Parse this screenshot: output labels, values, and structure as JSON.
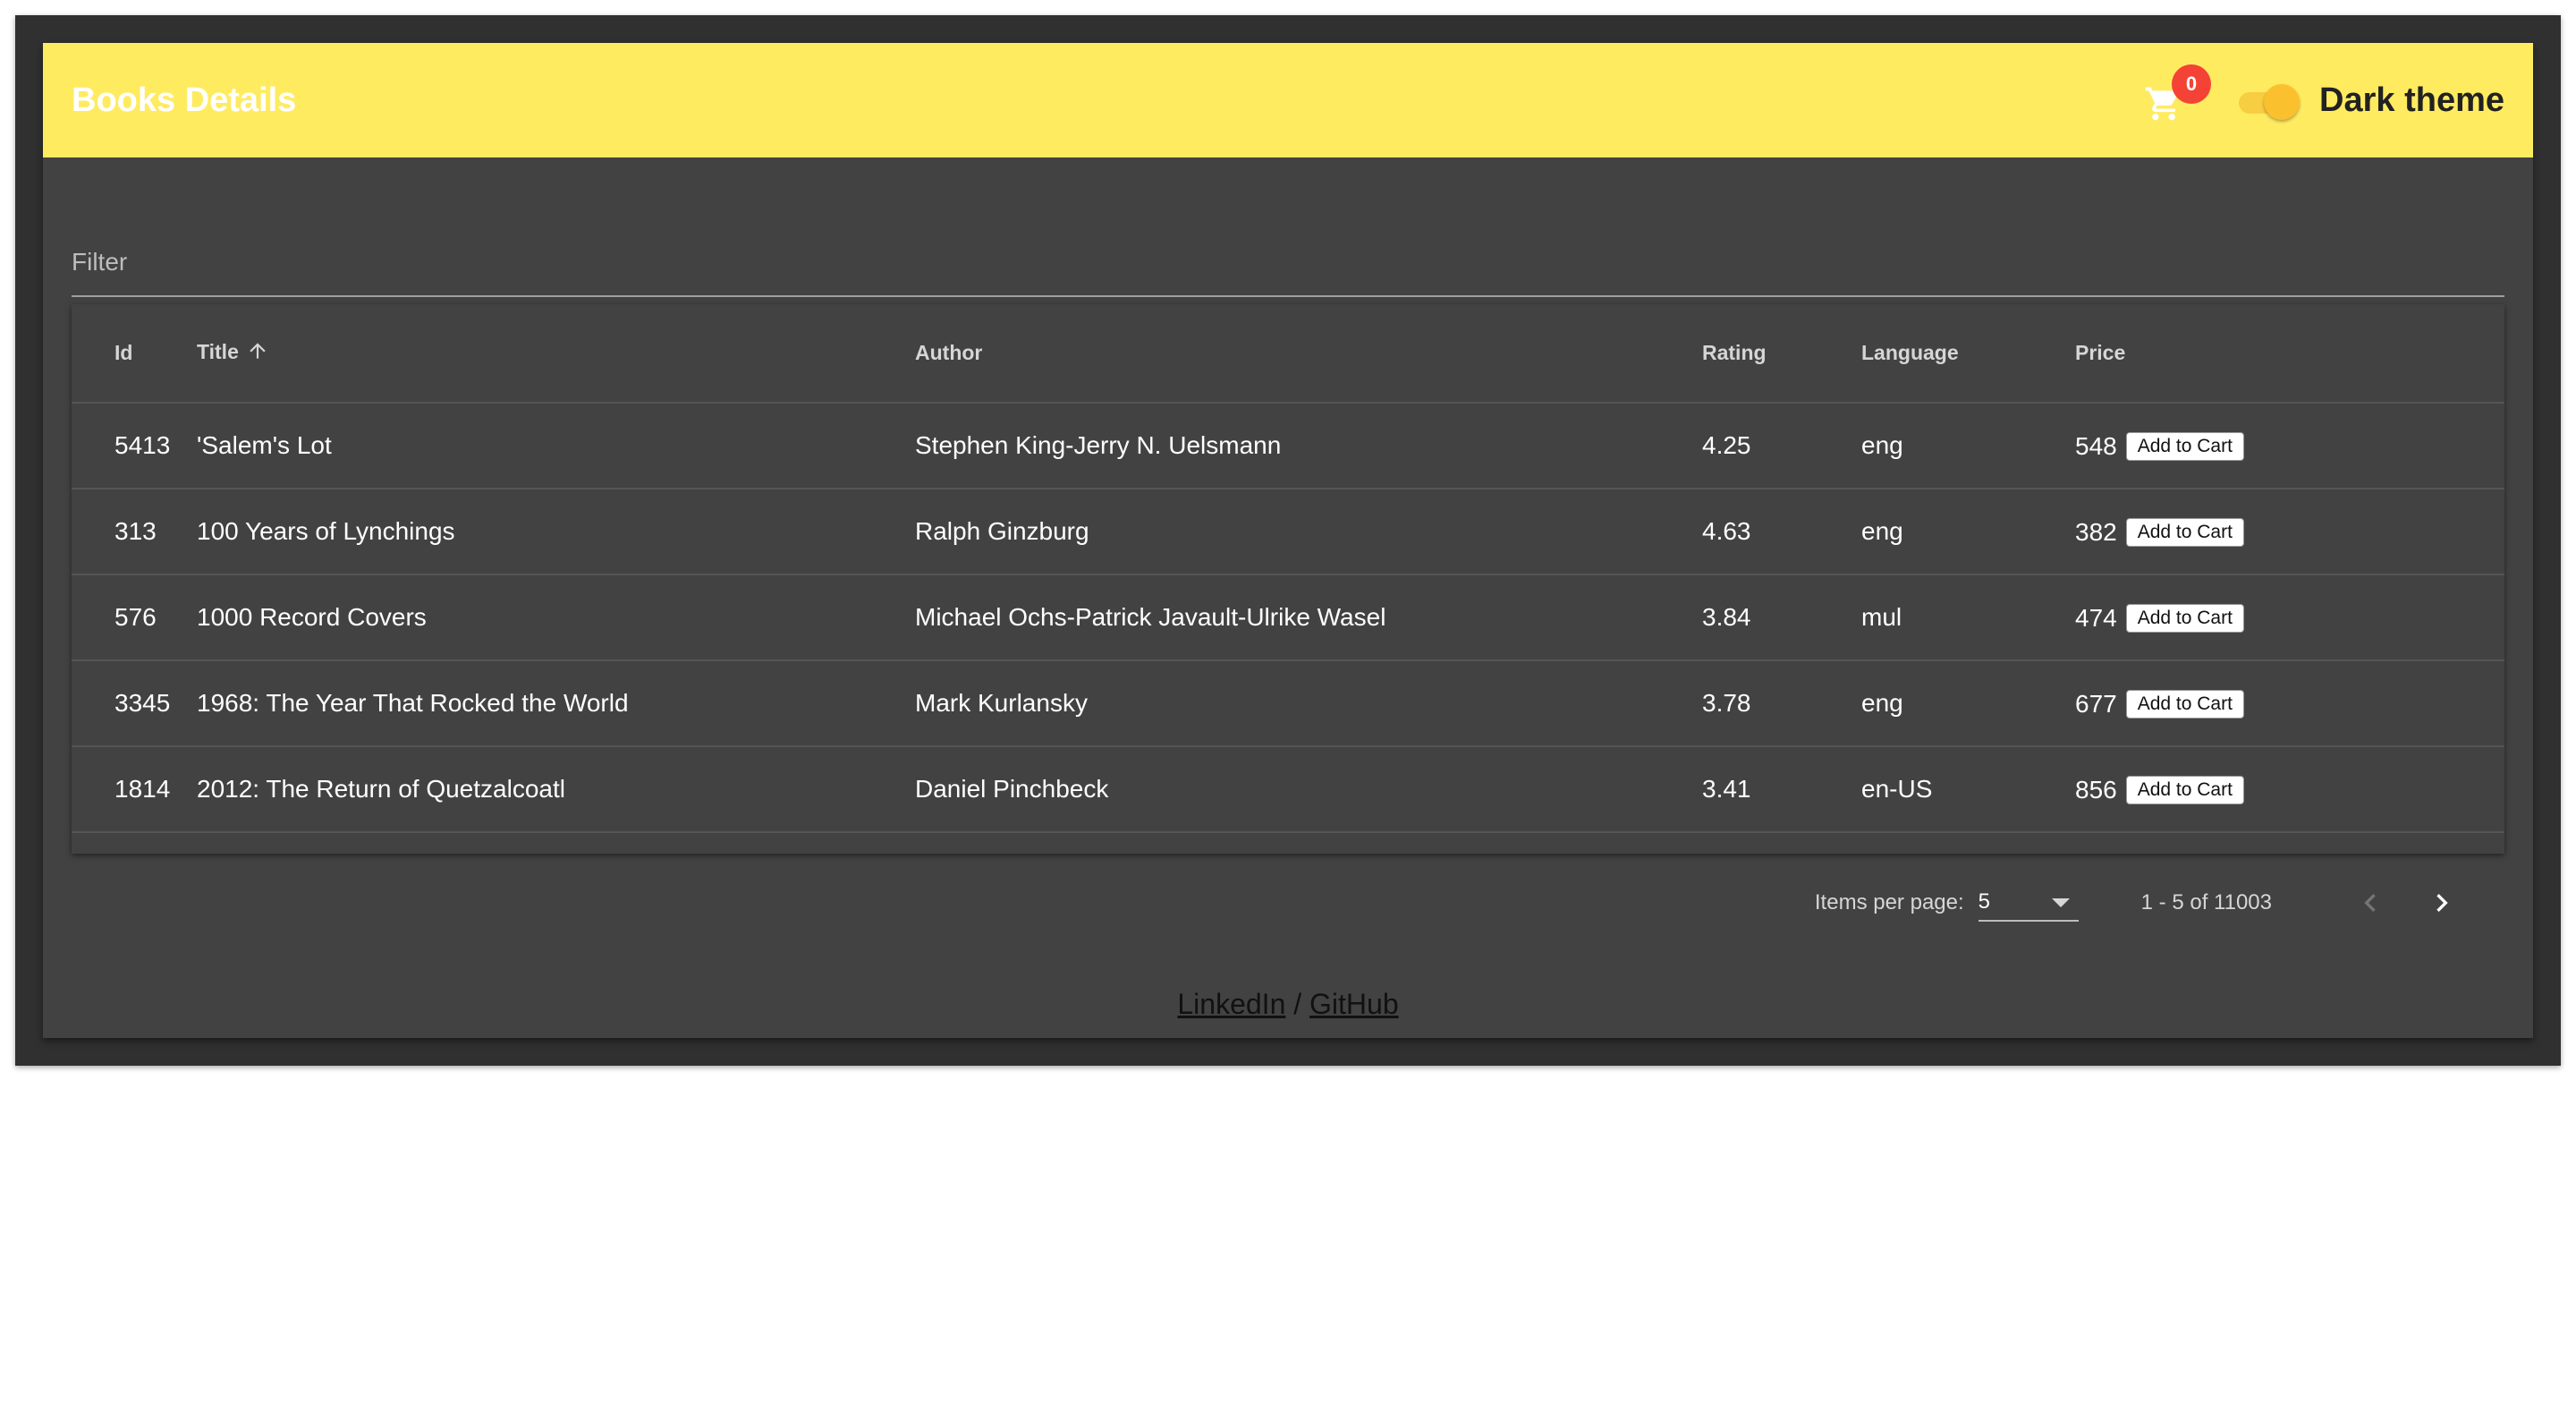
{
  "header": {
    "title": "Books Details",
    "cart_count": "0",
    "theme_label": "Dark theme",
    "dark_theme_on": true
  },
  "filter": {
    "placeholder": "Filter",
    "value": ""
  },
  "table": {
    "columns": {
      "id": "Id",
      "title": "Title",
      "author": "Author",
      "rating": "Rating",
      "language": "Language",
      "price": "Price"
    },
    "sort": {
      "column": "title",
      "direction": "asc",
      "icon": "arrow-up-icon"
    },
    "add_label": "Add to Cart",
    "rows": [
      {
        "id": "5413",
        "title": "'Salem's Lot",
        "author": "Stephen King-Jerry N. Uelsmann",
        "rating": "4.25",
        "language": "eng",
        "price": "548"
      },
      {
        "id": "313",
        "title": "100 Years of Lynchings",
        "author": "Ralph Ginzburg",
        "rating": "4.63",
        "language": "eng",
        "price": "382"
      },
      {
        "id": "576",
        "title": "1000 Record Covers",
        "author": "Michael Ochs-Patrick Javault-Ulrike Wasel",
        "rating": "3.84",
        "language": "mul",
        "price": "474"
      },
      {
        "id": "3345",
        "title": "1968: The Year That Rocked the World",
        "author": "Mark Kurlansky",
        "rating": "3.78",
        "language": "eng",
        "price": "677"
      },
      {
        "id": "1814",
        "title": "2012: The Return of Quetzalcoatl",
        "author": "Daniel Pinchbeck",
        "rating": "3.41",
        "language": "en-US",
        "price": "856"
      }
    ]
  },
  "paginator": {
    "items_per_page_label": "Items per page:",
    "items_per_page": "5",
    "range_label": "1 - 5 of 11003"
  },
  "footer": {
    "linkedin": "LinkedIn",
    "separator": "/",
    "github": "GitHub"
  },
  "colors": {
    "toolbar": "#ffeb60",
    "card": "#424242",
    "badge": "#f44336",
    "toggle": "#fbc02d"
  }
}
